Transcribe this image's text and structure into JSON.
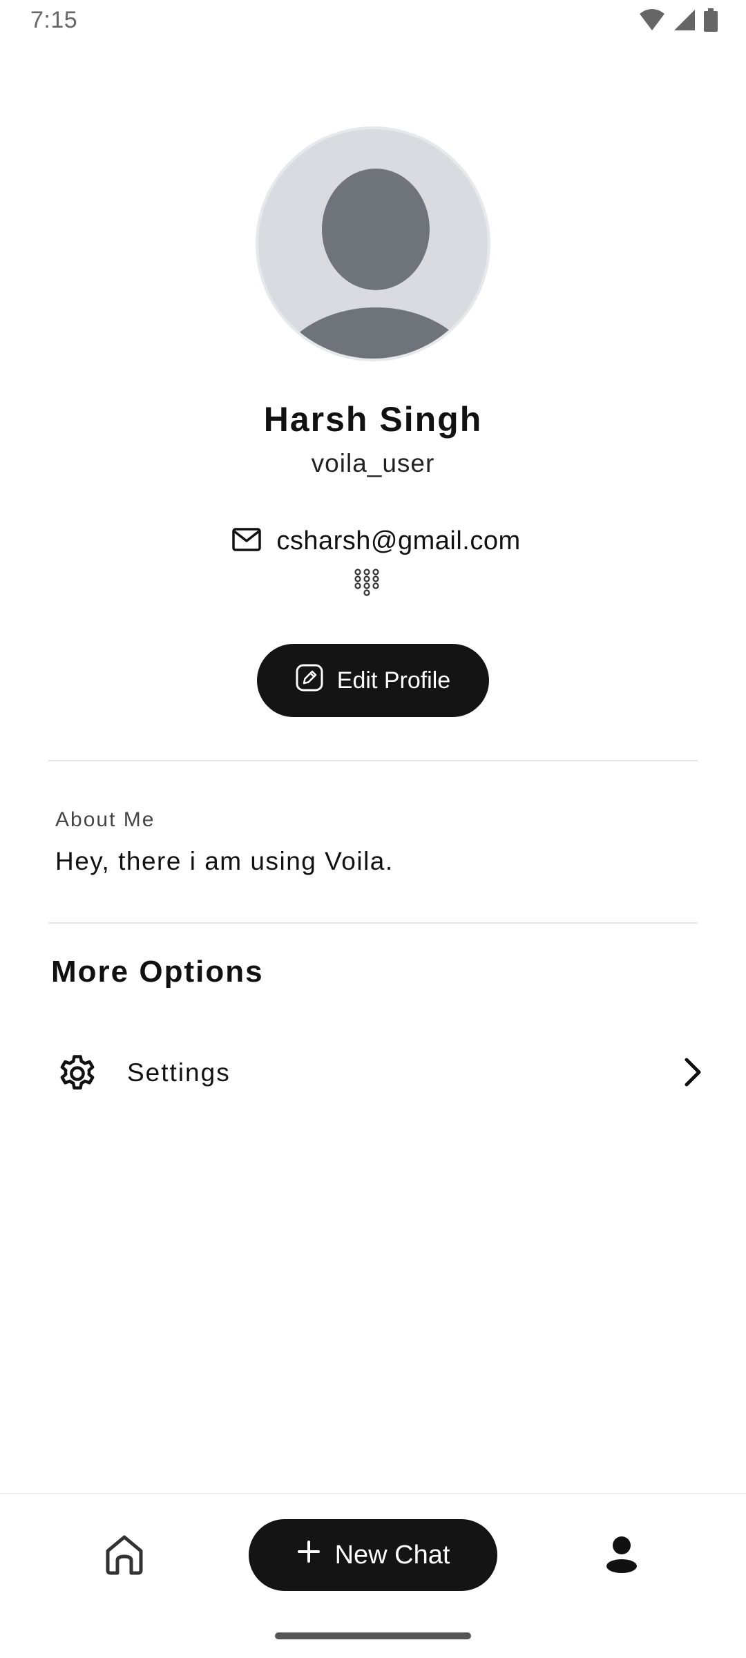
{
  "status_bar": {
    "time": "7:15",
    "icons": [
      "wifi-icon",
      "signal-icon",
      "battery-icon"
    ]
  },
  "profile": {
    "name": "Harsh Singh",
    "username": "voila_user",
    "email": "csharsh@gmail.com",
    "edit_button_label": "Edit Profile"
  },
  "about": {
    "label": "About Me",
    "text": "Hey, there i am using Voila."
  },
  "more_options": {
    "title": "More Options",
    "items": [
      {
        "label": "Settings",
        "icon": "gear-icon"
      }
    ]
  },
  "bottom_nav": {
    "new_chat_label": "New Chat",
    "items": [
      "home-icon",
      "profile-icon"
    ]
  },
  "colors": {
    "primary_button": "#141414",
    "avatar_bg": "#d9dbe0",
    "avatar_fg": "#6f747b"
  }
}
